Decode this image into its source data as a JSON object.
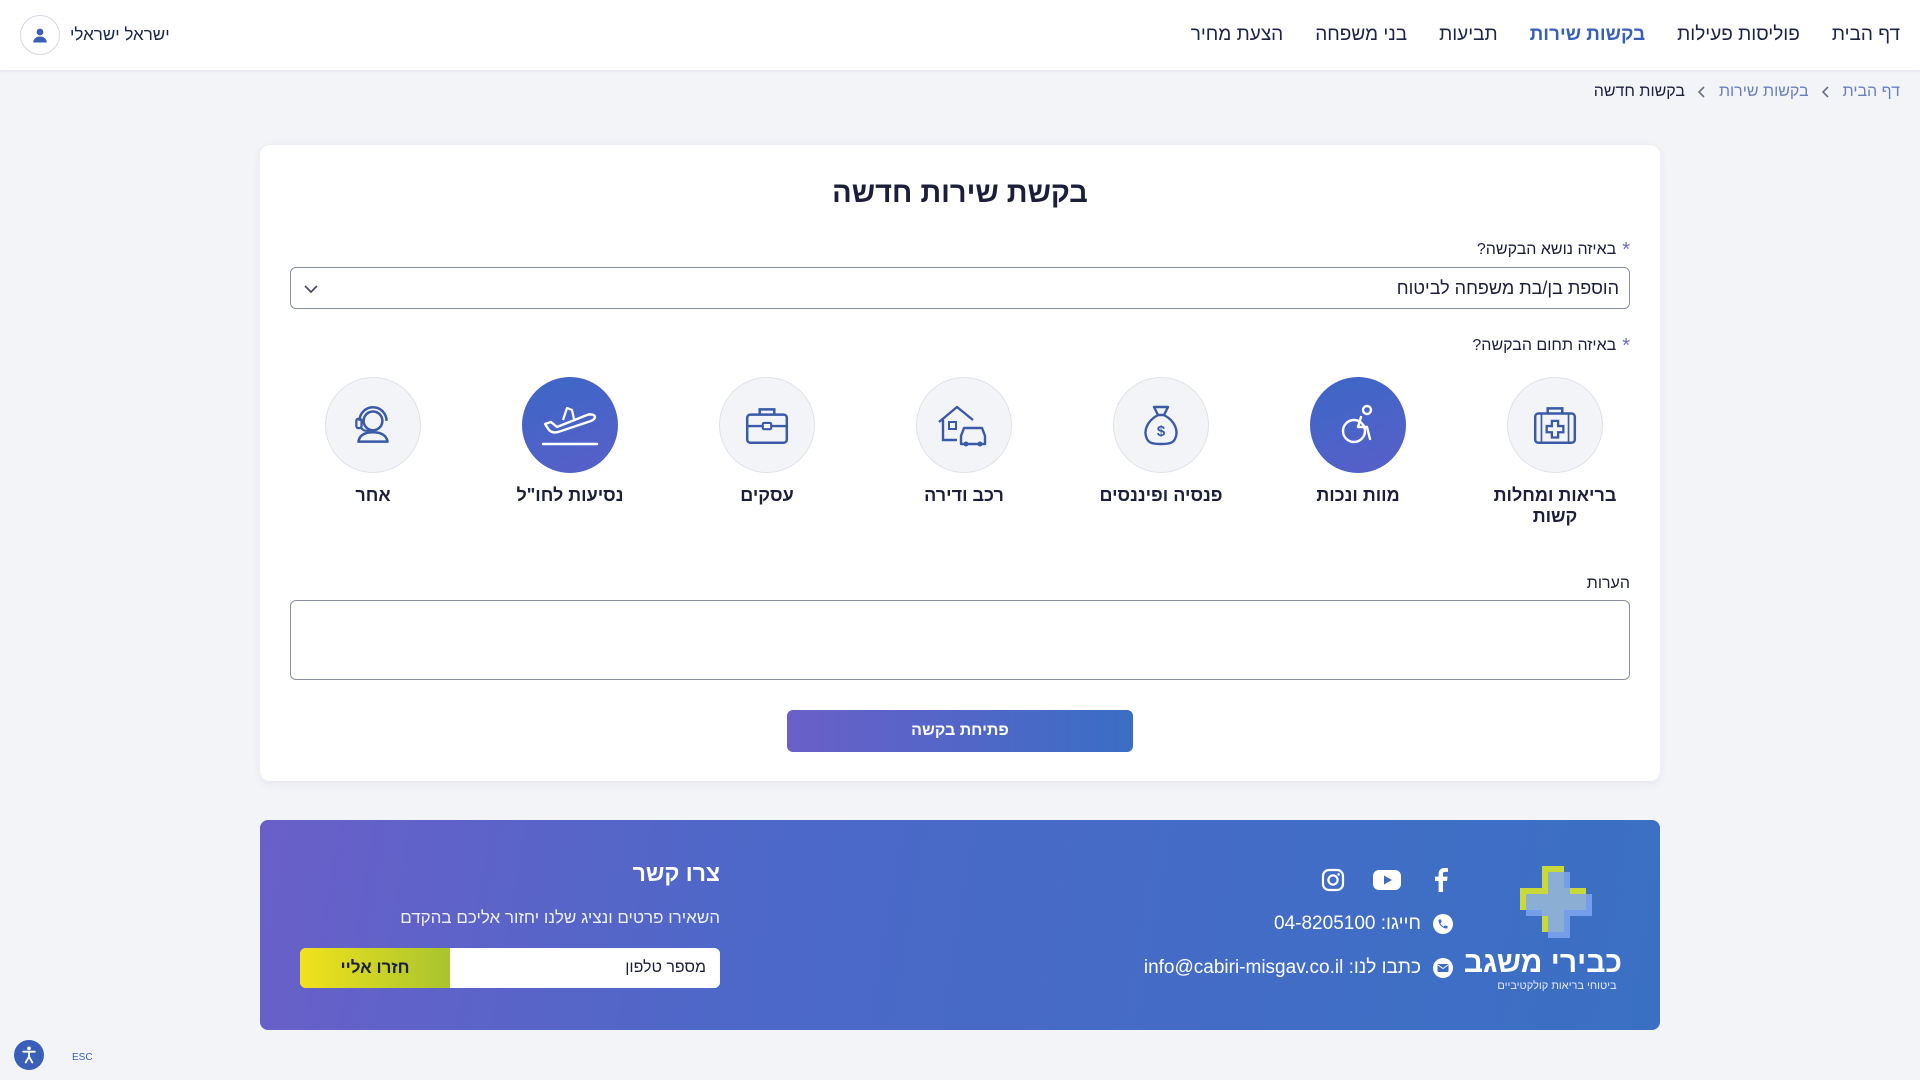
{
  "nav": {
    "items": [
      {
        "label": "דף הבית"
      },
      {
        "label": "פוליסות פעילות"
      },
      {
        "label": "בקשות שירות",
        "active": true
      },
      {
        "label": "תביעות"
      },
      {
        "label": "בני משפחה"
      },
      {
        "label": "הצעת מחיר"
      }
    ],
    "user_name": "ישראל ישראלי"
  },
  "breadcrumb": {
    "home": "דף הבית",
    "section": "בקשות שירות",
    "current": "בקשות חדשה"
  },
  "form": {
    "title": "בקשת שירות חדשה",
    "subject_label": "באיזה נושא הבקשה?",
    "subject_value": "הוספת בן/בת משפחה לביטוח",
    "required_mark": "*",
    "domain_label": "באיזה תחום הבקשה?",
    "categories": [
      {
        "label": "בריאות ומחלות קשות",
        "icon": "first-aid-kit-icon",
        "selected": false
      },
      {
        "label": "מוות ונכות",
        "icon": "wheelchair-icon",
        "selected": true
      },
      {
        "label": "פנסיה ופיננסים",
        "icon": "money-bag-icon",
        "selected": false
      },
      {
        "label": "רכב ודירה",
        "icon": "house-car-icon",
        "selected": false
      },
      {
        "label": "עסקים",
        "icon": "briefcase-icon",
        "selected": false
      },
      {
        "label": "נסיעות לחו\"ל",
        "icon": "airplane-icon",
        "selected": true
      },
      {
        "label": "אחר",
        "icon": "support-agent-icon",
        "selected": false
      }
    ],
    "notes_label": "הערות",
    "notes_value": "",
    "submit_label": "פתיחת בקשה"
  },
  "footer": {
    "logo_name": "כבירי משגב",
    "logo_tagline": "ביטוחי בריאות קולקטיביים",
    "socials": [
      "facebook-icon",
      "youtube-icon",
      "instagram-icon"
    ],
    "phone_text": "חייגו: 04-8205100",
    "email_text": "כתבו לנו: info@cabiri-misgav.co.il",
    "contact_title": "צרו קשר",
    "contact_subtitle": "השאירו פרטים ונציג שלנו יחזור אליכם בהקדם",
    "phone_placeholder": "מספר טלפון",
    "callback_label": "חזרו אליי"
  },
  "accessibility": {
    "esc_label": "ESC"
  },
  "colors": {
    "accent": "#3a5fb8",
    "page_bg": "#f3f4f8",
    "footer_gradient_start": "#6a5fc9",
    "footer_gradient_end": "#3a70c4",
    "cta_yellow": "#f1e21c",
    "cta_green": "#a8c42e"
  }
}
